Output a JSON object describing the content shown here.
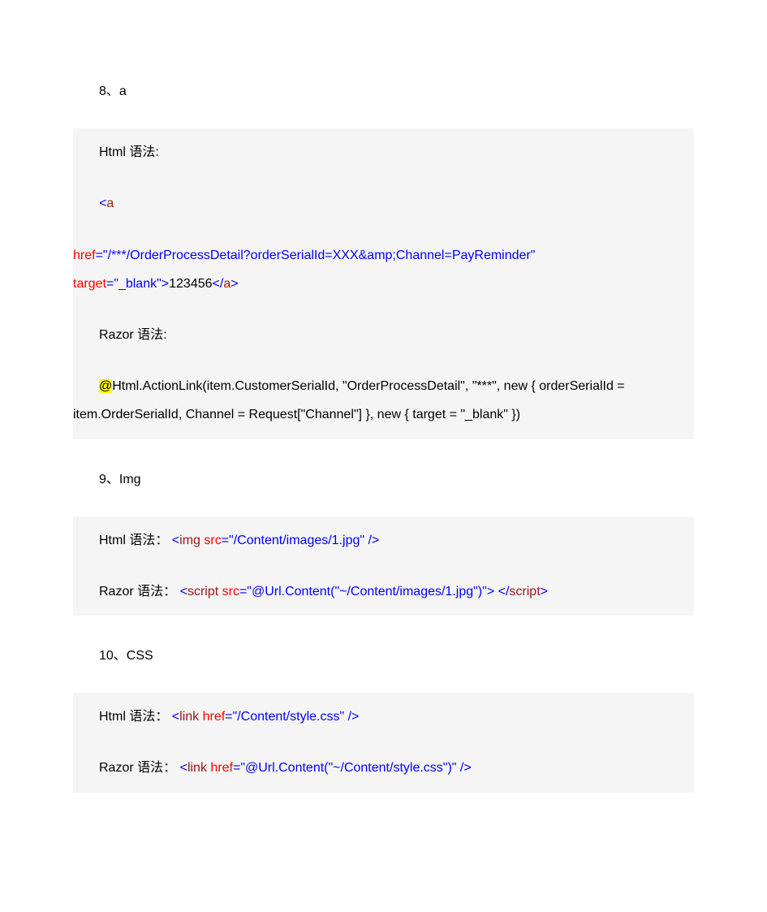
{
  "section8": {
    "heading": "8、a",
    "html_syntax_label": "Html 语法:",
    "html_code": {
      "open_tag": "<",
      "a": "a",
      "href_attr": "href",
      "href_eq": "=",
      "href_val": "\"/***/OrderProcessDetail?orderSerialId=XXX&amp;Channel=PayReminder\"",
      "target_attr": "target",
      "target_eq": "=",
      "target_val": "\"_blank\"",
      "gt": ">",
      "text": "123456",
      "close_lt": "</",
      "close_a": "a",
      "close_gt": ">"
    },
    "razor_syntax_label": "Razor 语法:",
    "razor_code": {
      "at": "@",
      "body": "Html.ActionLink(item.CustomerSerialId, \"OrderProcessDetail\", \"***\", new { orderSerialId = item.OrderSerialId, Channel = Request[\"Channel\"] }, new { target = \"_blank\" })"
    }
  },
  "section9": {
    "heading": "9、Img",
    "html_line": {
      "prefix": "Html  语法：",
      "lt": "<",
      "img": "img ",
      "src_attr": "src",
      "src_eq": "=",
      "src_val": "\"/Content/images/1.jpg\"",
      "close": " />"
    },
    "razor_line": {
      "prefix": "Razor 语法：",
      "lt": "<",
      "script": "script ",
      "src_attr": "src",
      "src_eq": "=",
      "src_val": "\"@Url.Content(\"~/Content/images/1.jpg\")\"",
      "gt": ">",
      "close_lt": "</",
      "close_script": "script",
      "close_gt": ">"
    }
  },
  "section10": {
    "heading": "10、CSS",
    "html_line": {
      "prefix": "Html  语法：",
      "lt": "<",
      "link": "link ",
      "href_attr": "href",
      "href_eq": "=",
      "href_val": "\"/Content/style.css\"",
      "close": " />"
    },
    "razor_line": {
      "prefix": "Razor 语法：",
      "lt": "<",
      "link": "link ",
      "href_attr": "href",
      "href_eq": "=",
      "href_val": "\"@Url.Content(\"~/Content/style.css\")\"",
      "close": " />"
    }
  }
}
